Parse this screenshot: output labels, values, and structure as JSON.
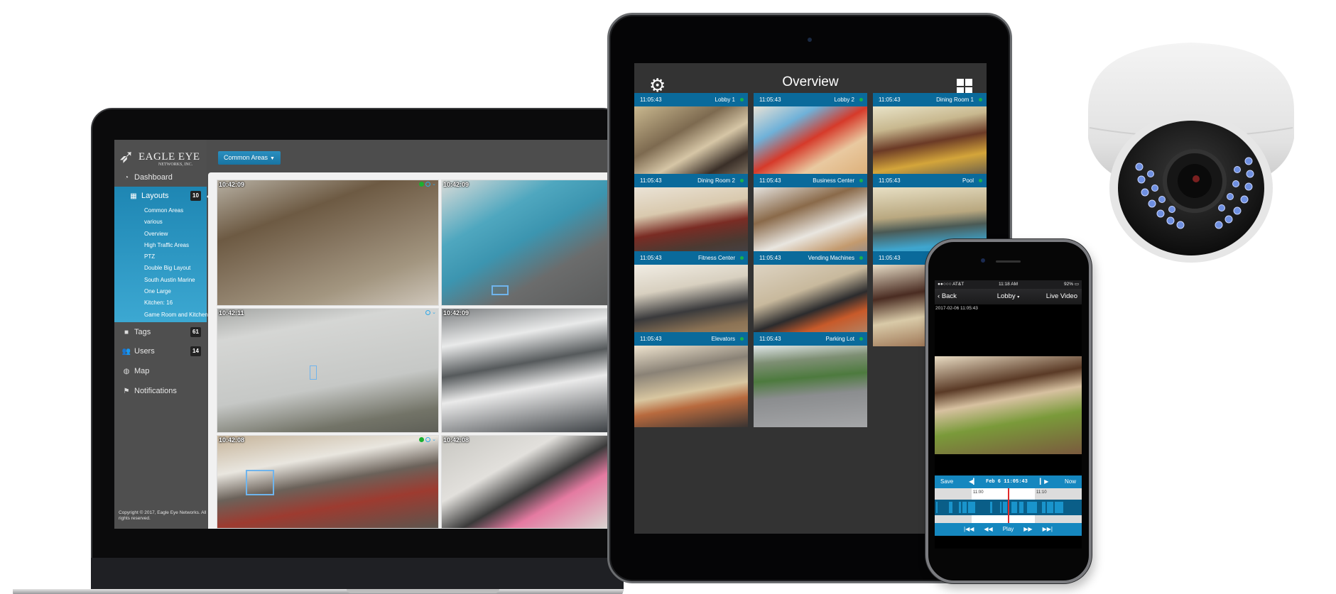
{
  "laptop": {
    "logo": {
      "name": "EAGLE EYE",
      "subtitle": "NETWORKS, INC."
    },
    "layout_dropdown": "Common Areas",
    "sidebar": {
      "dashboard": "Dashboard",
      "layouts": {
        "label": "Layouts",
        "count": "10",
        "items": [
          "Common Areas",
          "various",
          "Overview",
          "High Traffic Areas",
          "PTZ",
          "Double Big Layout",
          "South Austin Marine",
          "One Large",
          "Kitchen: 16",
          "Game Room and Kitchen"
        ]
      },
      "tags": {
        "label": "Tags",
        "count": "61"
      },
      "users": {
        "label": "Users",
        "count": "14"
      },
      "map": "Map",
      "notifications": "Notifications"
    },
    "copyright": "Copyright © 2017, Eagle Eye Networks. All rights reserved.",
    "cameras": [
      {
        "timestamp": "10:42:09",
        "live": true
      },
      {
        "timestamp": "10:42:09",
        "live": false
      },
      {
        "timestamp": "10:42:11",
        "live": false
      },
      {
        "timestamp": "10:42:09",
        "live": false
      },
      {
        "timestamp": "10:42:08",
        "live": true
      },
      {
        "timestamp": "10:42:08",
        "live": false
      }
    ]
  },
  "tablet": {
    "title": "Overview",
    "tiles": [
      {
        "time": "11:05:43",
        "name": "Lobby 1"
      },
      {
        "time": "11:05:43",
        "name": "Lobby 2"
      },
      {
        "time": "11:05:43",
        "name": "Dining Room 1"
      },
      {
        "time": "11:05:43",
        "name": "Dining Room 2"
      },
      {
        "time": "11:05:43",
        "name": "Business Center"
      },
      {
        "time": "11:05:43",
        "name": "Pool"
      },
      {
        "time": "11:05:43",
        "name": "Fitness Center"
      },
      {
        "time": "11:05:43",
        "name": "Vending Machines"
      },
      {
        "time": "11:05:43",
        "name": ""
      },
      {
        "time": "11:05:43",
        "name": "Elevators"
      },
      {
        "time": "11:05:43",
        "name": "Parking Lot"
      }
    ]
  },
  "phone": {
    "status": {
      "carrier": "●●○○○ AT&T",
      "time": "11:18 AM",
      "battery": "92%"
    },
    "nav": {
      "back": "Back",
      "camera": "Lobby",
      "mode": "Live Video"
    },
    "recording_date": "2017-02-06 11:05:43",
    "controls": {
      "save": "Save",
      "datetime": "Feb 6 11:05:43",
      "now": "Now",
      "play": "Play"
    },
    "timeline": {
      "ticks": [
        "11:00",
        "11:10"
      ]
    }
  },
  "colors": {
    "accent": "#1587bf",
    "tile_header": "#0a6a9b",
    "live": "#19b34a",
    "sidebar_active": "#1e86b3"
  }
}
